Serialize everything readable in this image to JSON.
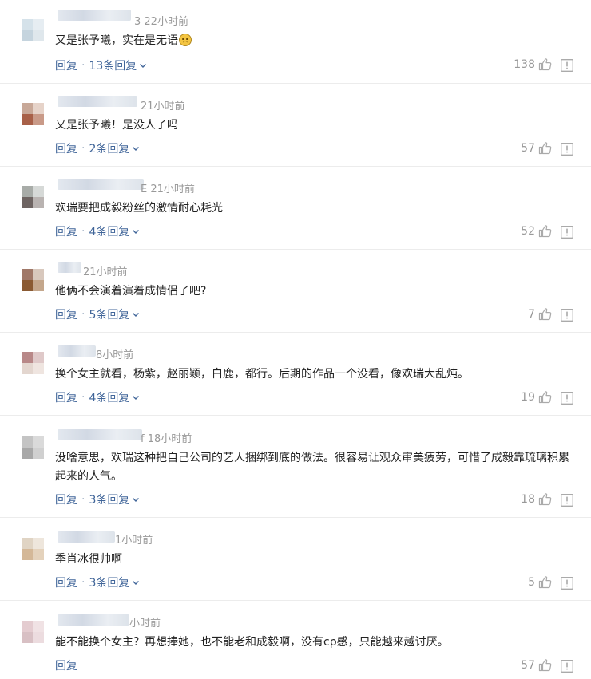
{
  "comments": [
    {
      "time_label": "3 22小时前",
      "text": "又是张予曦，实在是无语",
      "emoji": "disappointed-face",
      "reply_label": "回复",
      "replies_label": "13条回复",
      "likes": "138",
      "avatar_colors": [
        "#d5e2ea",
        "#e6edf2",
        "#c5d4de",
        "#dfe7ec"
      ]
    },
    {
      "time_label": "21小时前",
      "text": "又是张予曦！是没人了吗",
      "reply_label": "回复",
      "replies_label": "2条回复",
      "likes": "57",
      "avatar_colors": [
        "#c8a898",
        "#e6d3c9",
        "#a86048",
        "#c99a88"
      ]
    },
    {
      "time_label": "E 21小时前",
      "text": "欢瑞要把成毅粉丝的激情耐心耗光",
      "reply_label": "回复",
      "replies_label": "4条回复",
      "likes": "52",
      "avatar_colors": [
        "#a8aca8",
        "#d6d9d7",
        "#6e6462",
        "#b9b3b1"
      ]
    },
    {
      "time_label": "21小时前",
      "text": "他俩不会演着演着成情侣了吧?",
      "reply_label": "回复",
      "replies_label": "5条回复",
      "likes": "7",
      "avatar_colors": [
        "#a07868",
        "#d8c8bd",
        "#8a5a32",
        "#c4a78c"
      ]
    },
    {
      "time_label": "8小时前",
      "text": "换个女主就看，杨紫，赵丽颖，白鹿，都行。后期的作品一个没看，像欢瑞大乱炖。",
      "reply_label": "回复",
      "replies_label": "4条回复",
      "likes": "19",
      "avatar_colors": [
        "#b88888",
        "#dfc9c9",
        "#e3d6cf",
        "#efe5e0"
      ]
    },
    {
      "time_label": "f 18小时前",
      "text": "没啥意思，欢瑞这种把自己公司的艺人捆绑到底的做法。很容易让观众审美疲劳，可惜了成毅靠琉璃积累起来的人气。",
      "reply_label": "回复",
      "replies_label": "3条回复",
      "likes": "18",
      "avatar_colors": [
        "#c4c4c4",
        "#dadada",
        "#a8a8a8",
        "#d0d0d0"
      ]
    },
    {
      "time_label": "1小时前",
      "text": "季肖冰很帅啊",
      "reply_label": "回复",
      "replies_label": "3条回复",
      "likes": "5",
      "avatar_colors": [
        "#e0d4c4",
        "#eee6dc",
        "#d4b898",
        "#e4d2bc"
      ]
    },
    {
      "time_label": "小时前",
      "text": "能不能换个女主？再想捧她，也不能老和成毅啊，没有cp感，只能越来越讨厌。",
      "reply_label": "回复",
      "replies_label": "",
      "likes": "57",
      "avatar_colors": [
        "#e4ccd0",
        "#f0e2e4",
        "#d8c0c4",
        "#ecdcdf"
      ]
    }
  ]
}
